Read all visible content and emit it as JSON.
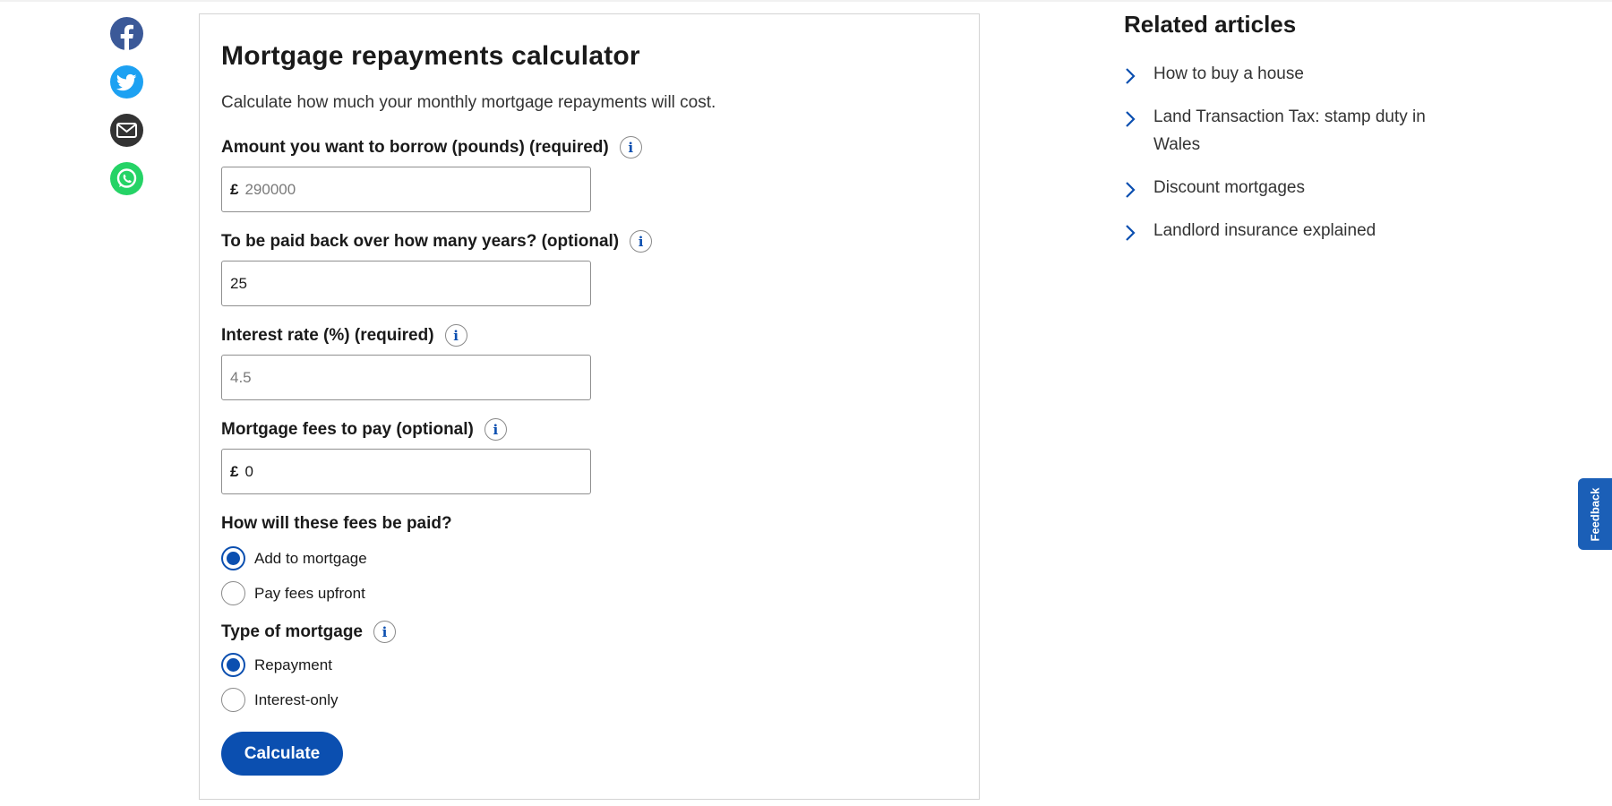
{
  "share": {
    "items": [
      {
        "name": "facebook",
        "color": "#3b5998"
      },
      {
        "name": "twitter",
        "color": "#1da1f2"
      },
      {
        "name": "email",
        "color": "#333333"
      },
      {
        "name": "whatsapp",
        "color": "#25d366"
      }
    ]
  },
  "calculator": {
    "title": "Mortgage repayments calculator",
    "intro": "Calculate how much your monthly mortgage repayments will cost.",
    "borrow": {
      "label": "Amount you want to borrow (pounds) (required)",
      "prefix": "£",
      "value": "",
      "placeholder": "290000"
    },
    "years": {
      "label": "To be paid back over how many years? (optional)",
      "value": "25",
      "placeholder": ""
    },
    "rate": {
      "label": "Interest rate (%) (required)",
      "value": "",
      "placeholder": "4.5"
    },
    "fees": {
      "label": "Mortgage fees to pay (optional)",
      "prefix": "£",
      "value": "0",
      "placeholder": ""
    },
    "fee_payment": {
      "label": "How will these fees be paid?",
      "options": [
        {
          "label": "Add to mortgage",
          "checked": true
        },
        {
          "label": "Pay fees upfront",
          "checked": false
        }
      ]
    },
    "mortgage_type": {
      "label": "Type of mortgage",
      "options": [
        {
          "label": "Repayment",
          "checked": true
        },
        {
          "label": "Interest-only",
          "checked": false
        }
      ]
    },
    "info_glyph": "i",
    "button_label": "Calculate"
  },
  "related": {
    "title": "Related articles",
    "items": [
      {
        "label": "How to buy a house"
      },
      {
        "label": "Land Transaction Tax: stamp duty in Wales"
      },
      {
        "label": "Discount mortgages"
      },
      {
        "label": "Landlord insurance explained"
      }
    ]
  },
  "feedback": {
    "label": "Feedback"
  },
  "colors": {
    "accent": "#0b4fb0",
    "feedback_tab": "#1b5fb7"
  }
}
